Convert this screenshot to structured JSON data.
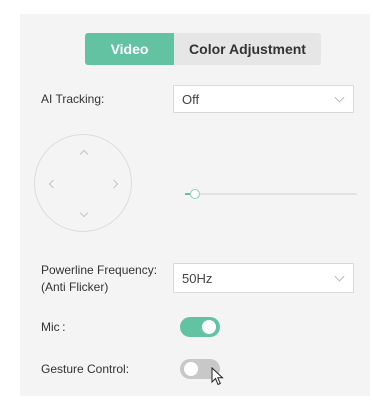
{
  "tabs": [
    {
      "label": "Video",
      "active": true
    },
    {
      "label": "Color Adjustment",
      "active": false
    }
  ],
  "ai_tracking": {
    "label": "AI Tracking:",
    "value": "Off"
  },
  "ptz": {
    "slider_value": 0.03
  },
  "powerline": {
    "label_line1": "Powerline Frequency:",
    "label_line2": "(Anti Flicker)",
    "value": "50Hz"
  },
  "mic": {
    "label": "Mic :",
    "enabled": true
  },
  "gesture": {
    "label": "Gesture Control:",
    "enabled": false
  },
  "colors": {
    "accent": "#63c2a2",
    "toggle_off": "#c8c8c8",
    "panel_bg": "#f4f4f4"
  },
  "icons": [
    "chevron-down-icon",
    "arrow-up-icon",
    "arrow-down-icon",
    "arrow-left-icon",
    "arrow-right-icon",
    "mouse-cursor-icon"
  ]
}
